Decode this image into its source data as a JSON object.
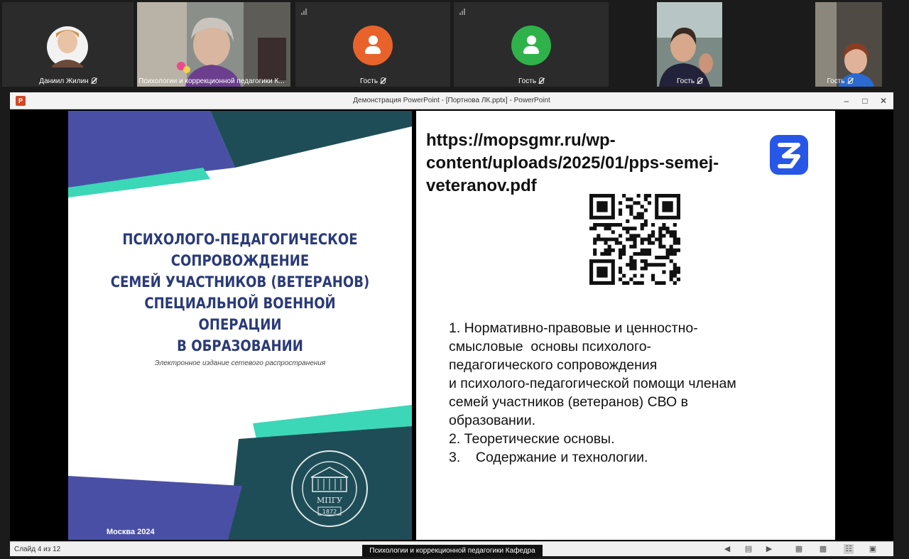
{
  "participants": [
    {
      "name": "Даниил Жилин",
      "kind": "photo",
      "photo_tone": "#f1f1f1"
    },
    {
      "name": "Психологии и коррекционной педагогики К...",
      "kind": "video",
      "active": true
    },
    {
      "name": "Гость",
      "kind": "avatar",
      "avatar_color": "#e8632b"
    },
    {
      "name": "Гость",
      "kind": "avatar",
      "avatar_color": "#2fb24a"
    },
    {
      "name": "Гость",
      "kind": "video"
    },
    {
      "name": "Гость",
      "kind": "video"
    }
  ],
  "window": {
    "title": "Демонстрация PowerPoint - [Портнова ЛК.pptx] - PowerPoint",
    "app_icon_letter": "P",
    "minimize_icon": "minimize-icon",
    "maximize_icon": "maximize-icon",
    "close_icon": "close-icon"
  },
  "cover_slide": {
    "title_lines": [
      "ПСИХОЛОГО-ПЕДАГОГИЧЕСКОЕ",
      "СОПРОВОЖДЕНИЕ",
      "СЕМЕЙ УЧАСТНИКОВ (ВЕТЕРАНОВ)",
      "СПЕЦИАЛЬНОЙ ВОЕННОЙ ОПЕРАЦИИ",
      "В ОБРАЗОВАНИИ"
    ],
    "subtitle": "Электронное издание сетевого распространения",
    "city_year": "Москва 2024",
    "seal_abbr": "МПГУ",
    "seal_year": "1872",
    "colors": {
      "navy": "#2a3a78",
      "teal": "#1f4d57",
      "mint": "#3cd7b7",
      "violet": "#4a4fa6"
    }
  },
  "content_slide": {
    "url_lines": [
      "https://mopsgmr.ru/wp-",
      "content/uploads/2025/01/pps-semej-",
      "veteranov.pdf"
    ],
    "logo_icon": "z-logo-icon",
    "list_lines": [
      "1. Нормативно-правовые и ценностно-",
      "смысловые  основы психолого-",
      "педагогического сопровождения",
      "и психолого-педагогической помощи членам",
      "семей участников (ветеранов) СВО в",
      "образовании.",
      "2. Теоретические основы.",
      "3.    Содержание и технологии."
    ]
  },
  "statusbar": {
    "slide_counter": "Слайд 4 из 12"
  },
  "speaker_caption": "Психологии и коррекционной педагогики Кафедра"
}
